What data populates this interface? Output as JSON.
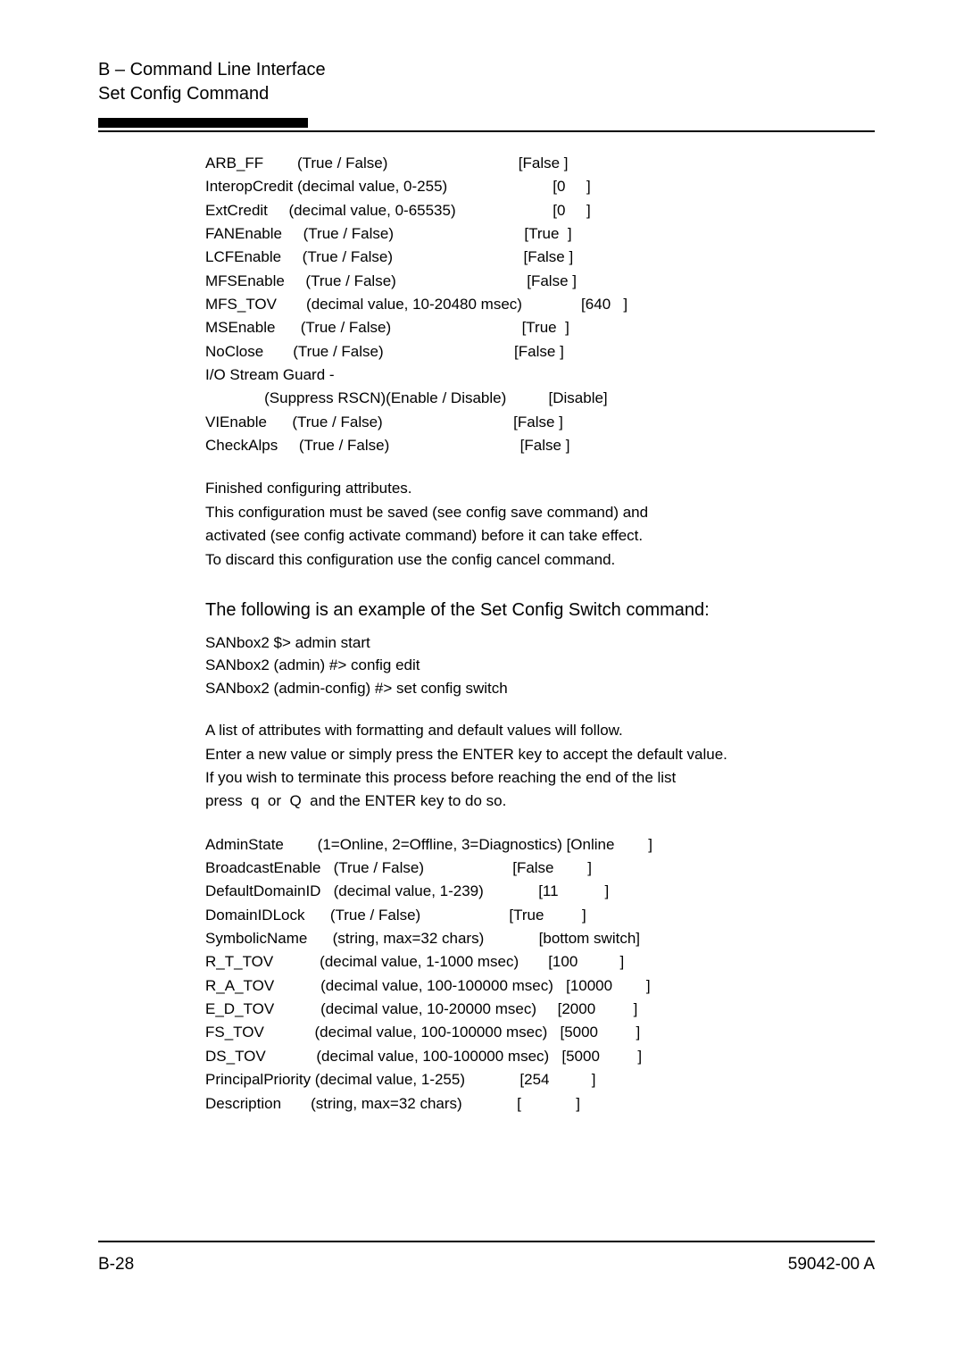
{
  "header": {
    "line1": "B – Command Line Interface",
    "line2": "Set Config Command"
  },
  "attrs1": [
    "ARB_FF        (True / False)                               [False ]",
    "InteropCredit (decimal value, 0-255)                         [0     ]",
    "ExtCredit     (decimal value, 0-65535)                       [0     ]",
    "FANEnable     (True / False)                               [True  ]",
    "LCFEnable     (True / False)                               [False ]",
    "MFSEnable     (True / False)                               [False ]",
    "MFS_TOV       (decimal value, 10-20480 msec)              [640   ]",
    "MSEnable      (True / False)                               [True  ]",
    "NoClose       (True / False)                               [False ]",
    "I/O Stream Guard -",
    "              (Suppress RSCN)(Enable / Disable)          [Disable]",
    "VIEnable      (True / False)                               [False ]",
    "CheckAlps     (True / False)                               [False ]"
  ],
  "notes1": [
    "Finished configuring attributes.",
    "This configuration must be saved (see config save command) and",
    "activated (see config activate command) before it can take effect.",
    "To discard this configuration use the config cancel command."
  ],
  "section_heading": "The following is an example of the Set Config Switch command:",
  "cmds": [
    "SANbox2 $> admin start",
    "SANbox2 (admin) #> config edit",
    "SANbox2 (admin-config) #> set config switch"
  ],
  "notes2": [
    "A list of attributes with formatting and default values will follow.",
    "Enter a new value or simply press the ENTER key to accept the default value.",
    "If you wish to terminate this process before reaching the end of the list",
    "press  q  or  Q  and the ENTER key to do so."
  ],
  "attrs2": [
    "AdminState        (1=Online, 2=Offline, 3=Diagnostics) [Online        ]",
    "BroadcastEnable   (True / False)                     [False        ]",
    "DefaultDomainID   (decimal value, 1-239)             [11           ]",
    "DomainIDLock      (True / False)                     [True         ]",
    "SymbolicName      (string, max=32 chars)             [bottom switch]",
    "R_T_TOV           (decimal value, 1-1000 msec)       [100          ]",
    "R_A_TOV           (decimal value, 100-100000 msec)   [10000        ]",
    "E_D_TOV           (decimal value, 10-20000 msec)     [2000         ]",
    "FS_TOV            (decimal value, 100-100000 msec)   [5000         ]",
    "DS_TOV            (decimal value, 100-100000 msec)   [5000         ]",
    "PrincipalPriority (decimal value, 1-255)             [254          ]",
    "Description       (string, max=32 chars)             [             ]"
  ],
  "footer": {
    "left": "B-28",
    "right": "59042-00  A"
  }
}
